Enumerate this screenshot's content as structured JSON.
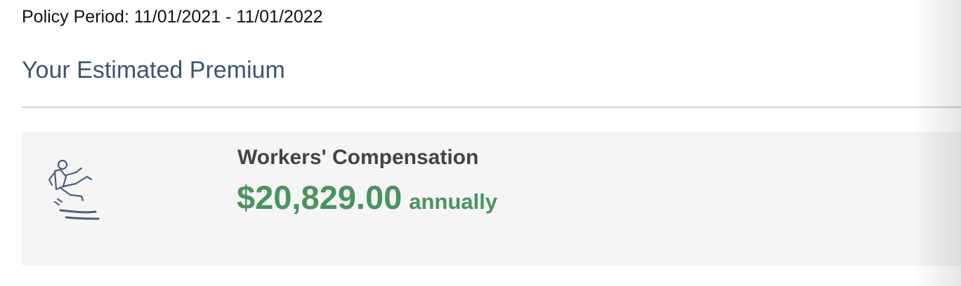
{
  "policy": {
    "period_text": "Policy Period: 11/01/2021 - 11/01/2022"
  },
  "premium": {
    "title": "Your Estimated Premium"
  },
  "coverage": {
    "name": "Workers' Compensation",
    "amount": "$20,829.00",
    "frequency": "annually",
    "icon": "slip-fall-icon"
  },
  "colors": {
    "title": "#3c5470",
    "amount": "#4a935f",
    "card_background": "#f5f5f5",
    "icon_stroke": "#4a5f7a"
  }
}
